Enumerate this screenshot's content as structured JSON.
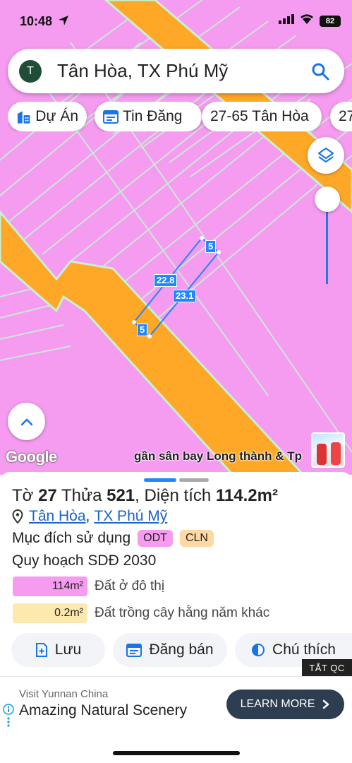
{
  "status": {
    "time": "10:48",
    "battery": "82"
  },
  "search": {
    "avatar_letter": "T",
    "text": "Tân Hòa, TX Phú Mỹ"
  },
  "chips": [
    {
      "label": "Dự Án",
      "icon": "building-icon"
    },
    {
      "label": "Tin Đăng",
      "icon": "calendar-icon"
    },
    {
      "label": "27-65 Tân Hòa"
    },
    {
      "label": "27"
    }
  ],
  "map": {
    "google_label": "Google",
    "caption": "gần sân bay Long thành & Tp",
    "dimensions": {
      "top": "5",
      "left": "22.8",
      "right": "23.1",
      "bottom": "5"
    },
    "colors": {
      "land": "#f59bf0",
      "road": "#ffa726",
      "grid": "#c7f0d4",
      "parcel": "#1e88ff"
    }
  },
  "parcel": {
    "sheet_label": "Tờ",
    "sheet_no": "27",
    "lot_label": "Thửa",
    "lot_no": "521",
    "area_label": ", Diện tích",
    "area": "114.2m²",
    "commune": "Tân Hòa",
    "separator": ",",
    "town": "TX Phú Mỹ",
    "purpose_label": "Mục đích sử dụng",
    "purposes": [
      "ODT",
      "CLN"
    ],
    "plan_title": "Quy hoạch SDĐ 2030",
    "land_uses": [
      {
        "area": "114m²",
        "name": "Đất ở đô thị",
        "color": "#f59bf0"
      },
      {
        "area": "0.2m²",
        "name": "Đất trồng cây hằng năm khác",
        "color": "#fde9ae"
      }
    ]
  },
  "actions": {
    "save": "Lưu",
    "post": "Đăng bán",
    "legend": "Chú thích"
  },
  "ad": {
    "close_label": "TẮT QC",
    "subtitle": "Visit Yunnan China",
    "title": "Amazing Natural Scenery",
    "button": "LEARN MORE"
  }
}
